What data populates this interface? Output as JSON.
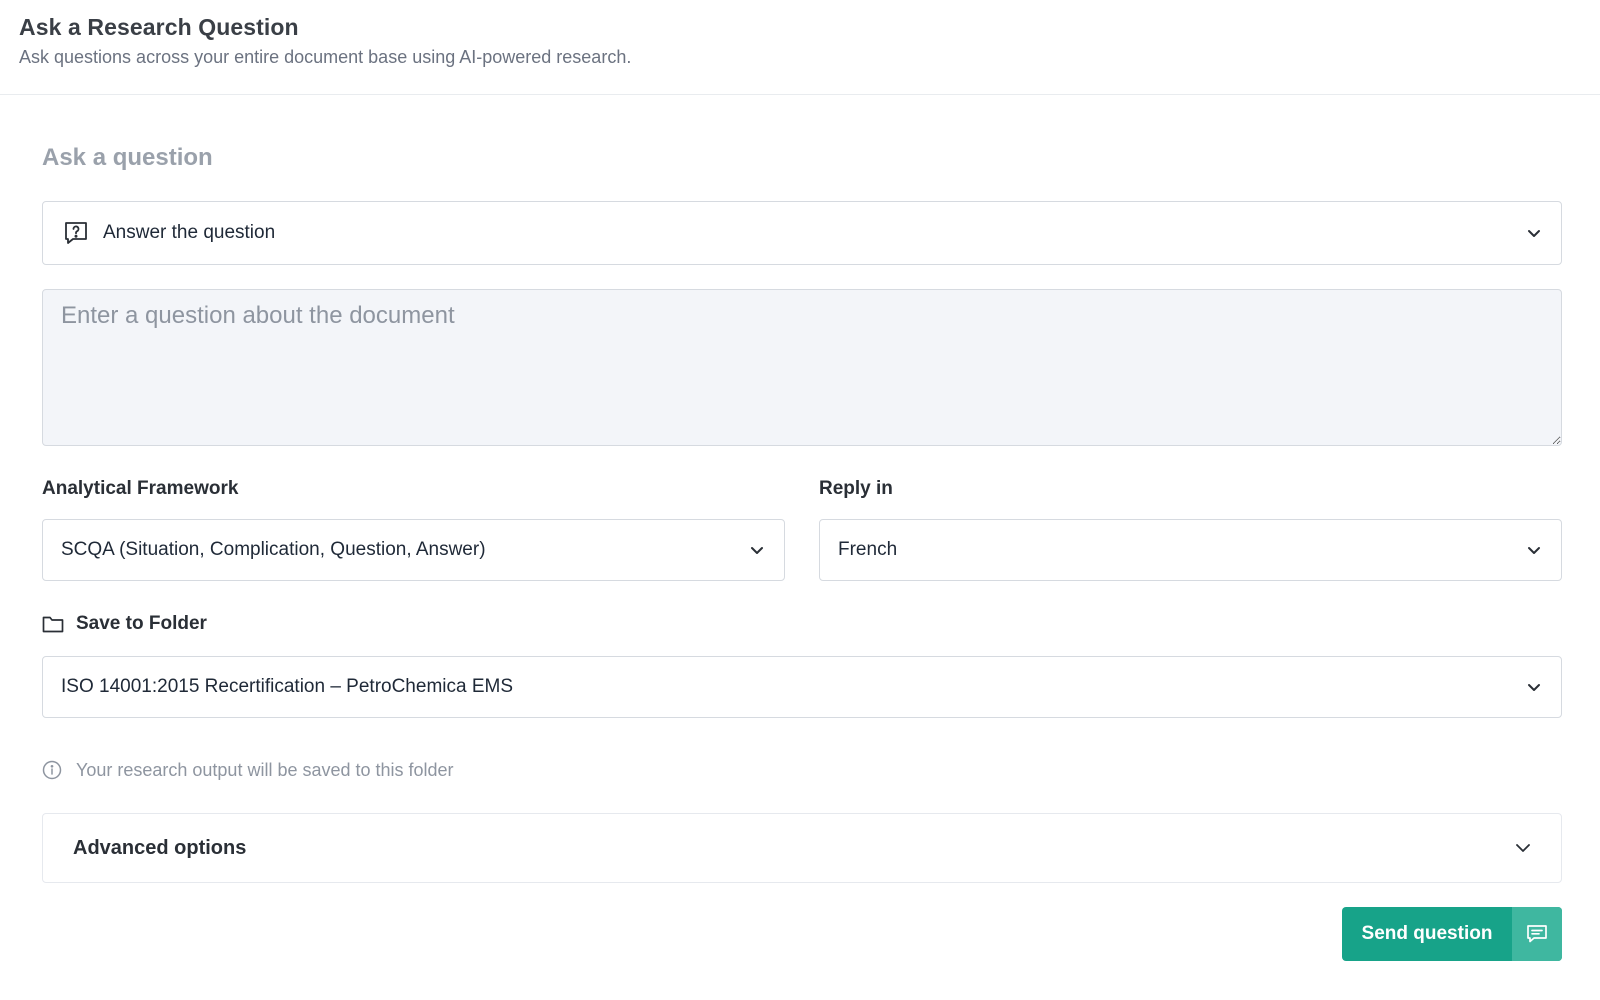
{
  "header": {
    "title": "Ask a Research Question",
    "subtitle": "Ask questions across your entire document base using AI-powered research."
  },
  "form": {
    "section_heading": "Ask a question",
    "mode": {
      "icon": "question-bubble-icon",
      "selected": "Answer the question"
    },
    "question": {
      "value": "",
      "placeholder": "Enter a question about the document"
    },
    "framework": {
      "label": "Analytical Framework",
      "selected": "SCQA (Situation, Complication, Question, Answer)"
    },
    "reply_language": {
      "label": "Reply in",
      "selected": "French"
    },
    "folder": {
      "icon": "folder-icon",
      "label": "Save to Folder",
      "selected": "ISO 14001:2015 Recertification – PetroChemica EMS",
      "hint": "Your research output will be saved to this folder"
    },
    "advanced": {
      "label": "Advanced options"
    },
    "submit": {
      "label": "Send question",
      "icon": "message-icon"
    }
  },
  "colors": {
    "primary": "#17a389",
    "primary_light": "#3fb7a0",
    "input_bg": "#f3f5f9",
    "border": "#d6dae0",
    "muted_text": "#8e95a0"
  }
}
